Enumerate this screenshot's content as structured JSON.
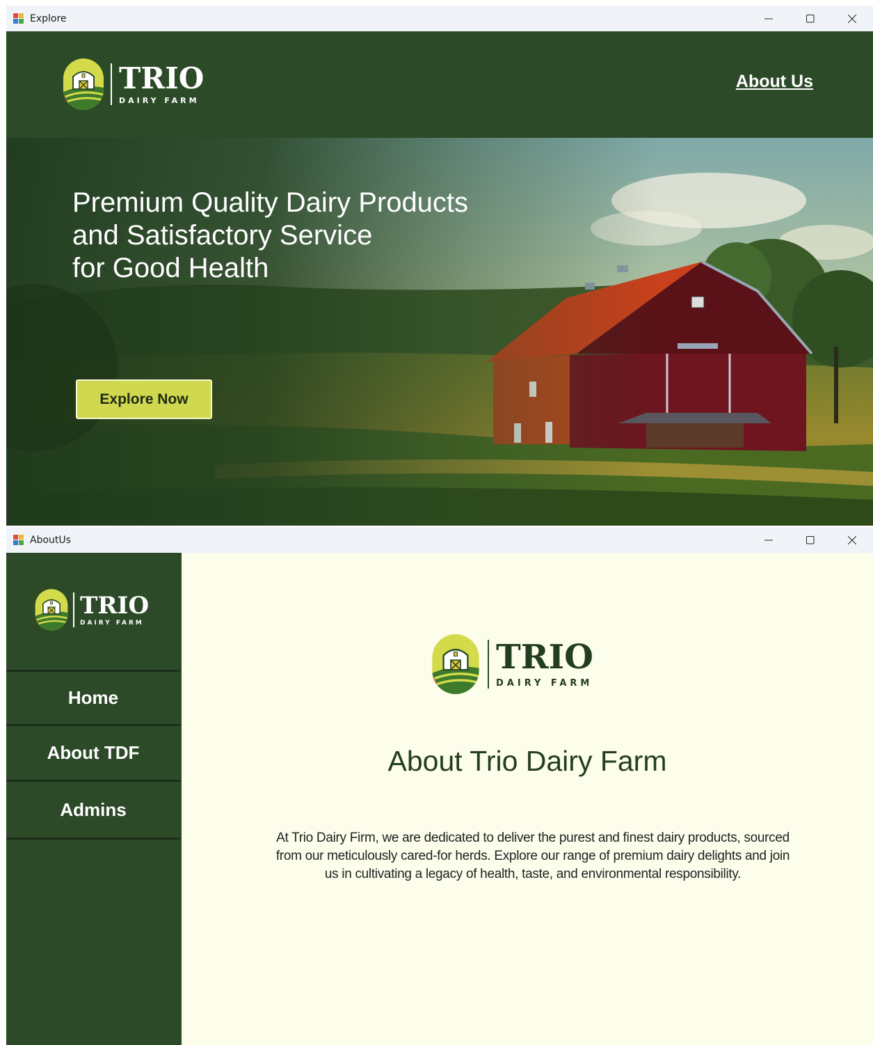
{
  "explore_window": {
    "title": "Explore",
    "logo": {
      "word": "TRIO",
      "subtitle": "DAIRY FARM"
    },
    "nav": {
      "about_link": "About Us"
    },
    "hero": {
      "headline_lines": [
        "Premium Quality Dairy Products",
        "and Satisfactory Service",
        "for Good Health"
      ],
      "cta_label": "Explore Now"
    }
  },
  "about_window": {
    "title": "AboutUs",
    "logo": {
      "word": "TRIO",
      "subtitle": "DAIRY FARM"
    },
    "sidebar": {
      "items": [
        {
          "label": "Home"
        },
        {
          "label": "About TDF"
        },
        {
          "label": "Admins"
        }
      ]
    },
    "main": {
      "logo": {
        "word": "TRIO",
        "subtitle": "DAIRY FARM"
      },
      "heading": "About Trio Dairy Farm",
      "body": "At Trio Dairy Firm, we are dedicated to deliver the purest and finest dairy products, sourced from our meticulously cared-for herds. Explore our range of premium dairy delights and join us in cultivating a legacy of health, taste, and environmental responsibility."
    }
  },
  "window_controls": {
    "icons": [
      "minimize-icon",
      "maximize-icon",
      "close-icon"
    ]
  },
  "colors": {
    "header_green": "#2c4a28",
    "cta_yellow": "#cfd84e",
    "content_cream": "#fdfdec",
    "barn_red": "#7a1a22",
    "roof_orange": "#c8401c"
  }
}
